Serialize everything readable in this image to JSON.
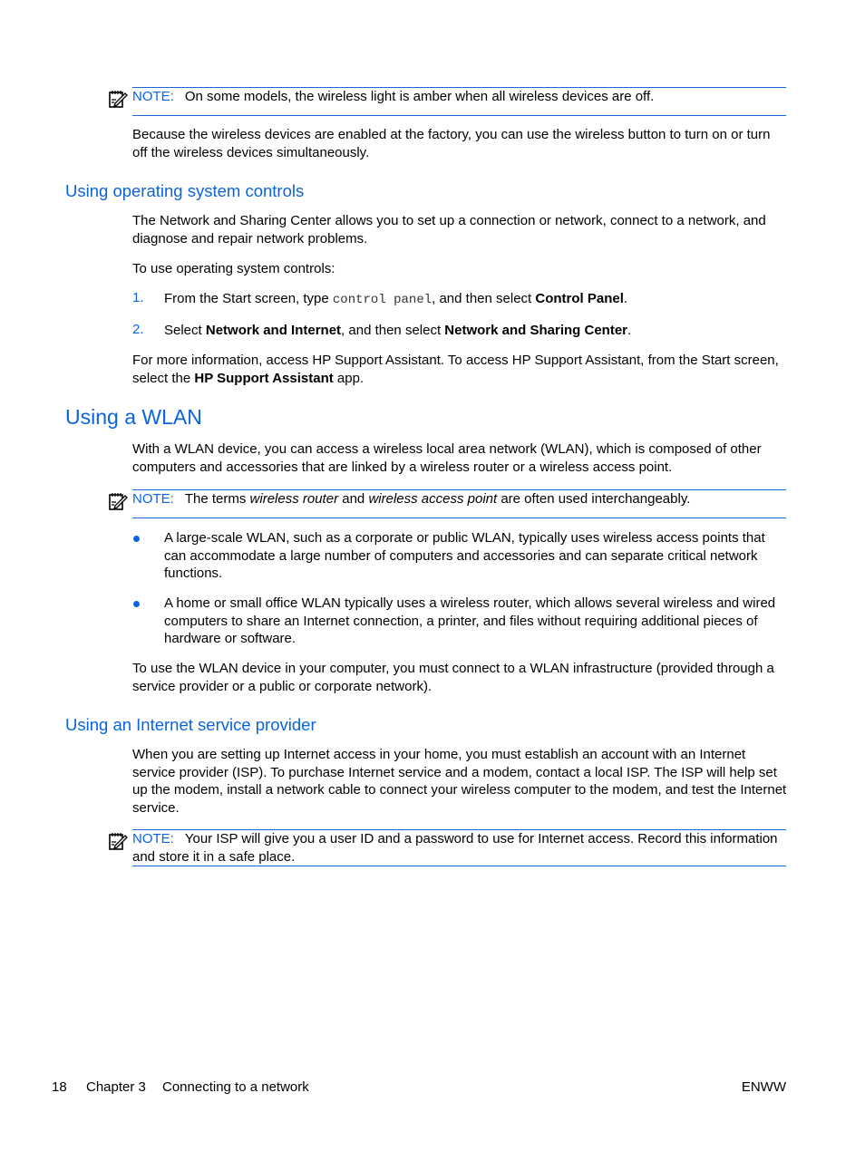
{
  "note_label": "NOTE:",
  "note1": {
    "text": "On some models, the wireless light is amber when all wireless devices are off."
  },
  "para_factory": "Because the wireless devices are enabled at the factory, you can use the wireless button to turn on or turn off the wireless devices simultaneously.",
  "section_os": {
    "heading": "Using operating system controls",
    "intro": "The Network and Sharing Center allows you to set up a connection or network, connect to a network, and diagnose and repair network problems.",
    "lead": "To use operating system controls:",
    "steps": [
      {
        "num": "1.",
        "pre": "From the Start screen, type ",
        "code": "control panel",
        "mid": ", and then select ",
        "bold": "Control Panel",
        "post": "."
      },
      {
        "num": "2.",
        "pre": "Select ",
        "bold1": "Network and Internet",
        "mid": ", and then select ",
        "bold2": "Network and Sharing Center",
        "post": "."
      }
    ],
    "more_pre": "For more information, access HP Support Assistant. To access HP Support Assistant, from the Start screen, select the ",
    "more_bold": "HP Support Assistant",
    "more_post": " app."
  },
  "section_wlan": {
    "heading": "Using a WLAN",
    "intro": "With a WLAN device, you can access a wireless local area network (WLAN), which is composed of other computers and accessories that are linked by a wireless router or a wireless access point.",
    "note": {
      "pre": "The terms ",
      "em1": "wireless router",
      "mid": " and ",
      "em2": "wireless access point",
      "post": " are often used interchangeably."
    },
    "bullets": [
      "A large-scale WLAN, such as a corporate or public WLAN, typically uses wireless access points that can accommodate a large number of computers and accessories and can separate critical network functions.",
      "A home or small office WLAN typically uses a wireless router, which allows several wireless and wired computers to share an Internet connection, a printer, and files without requiring additional pieces of hardware or software."
    ],
    "outro": "To use the WLAN device in your computer, you must connect to a WLAN infrastructure (provided through a service provider or a public or corporate network)."
  },
  "section_isp": {
    "heading": "Using an Internet service provider",
    "intro": "When you are setting up Internet access in your home, you must establish an account with an Internet service provider (ISP). To purchase Internet service and a modem, contact a local ISP. The ISP will help set up the modem, install a network cable to connect your wireless computer to the modem, and test the Internet service.",
    "note": "Your ISP will give you a user ID and a password to use for Internet access. Record this information and store it in a safe place."
  },
  "footer": {
    "page_number": "18",
    "chapter": "Chapter 3",
    "chapter_title": "Connecting to a network",
    "locale": "ENWW"
  },
  "colors": {
    "accent": "#0a64dc"
  }
}
